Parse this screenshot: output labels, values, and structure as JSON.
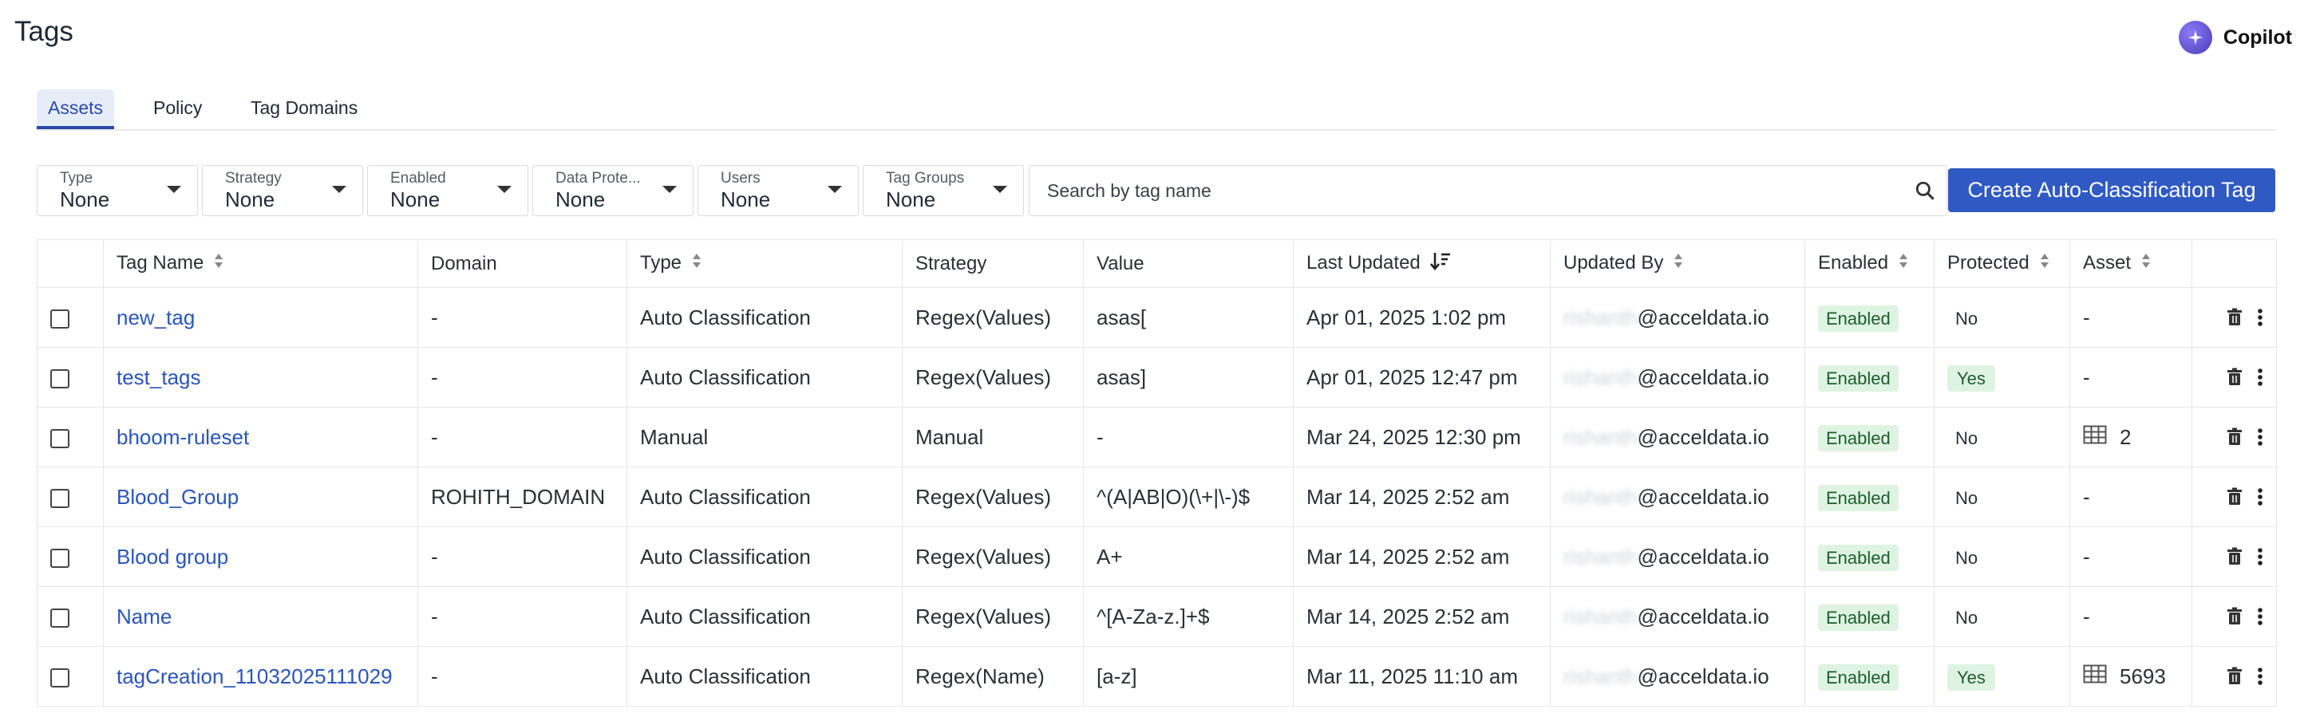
{
  "page": {
    "title": "Tags"
  },
  "copilot": {
    "label": "Copilot"
  },
  "tabs": [
    {
      "label": "Assets",
      "active": true
    },
    {
      "label": "Policy",
      "active": false
    },
    {
      "label": "Tag Domains",
      "active": false
    }
  ],
  "filters": [
    {
      "label": "Type",
      "value": "None"
    },
    {
      "label": "Strategy",
      "value": "None"
    },
    {
      "label": "Enabled",
      "value": "None"
    },
    {
      "label": "Data Prote...",
      "value": "None"
    },
    {
      "label": "Users",
      "value": "None"
    },
    {
      "label": "Tag Groups",
      "value": "None"
    }
  ],
  "search": {
    "placeholder": "Search by tag name"
  },
  "create_button": {
    "label": "Create Auto-Classification Tag"
  },
  "table": {
    "headers": {
      "tag_name": "Tag Name",
      "domain": "Domain",
      "type": "Type",
      "strategy": "Strategy",
      "value": "Value",
      "last_updated": "Last Updated",
      "updated_by": "Updated By",
      "enabled": "Enabled",
      "protected": "Protected",
      "asset": "Asset"
    },
    "rows": [
      {
        "name": "new_tag",
        "domain": "-",
        "type": "Auto Classification",
        "strategy": "Regex(Values)",
        "value": "asas[",
        "updated": "Apr 01, 2025 1:02 pm",
        "user_blur": "rishanth",
        "user_domain": "@acceldata.io",
        "enabled": "Enabled",
        "protected": "No",
        "asset": "-"
      },
      {
        "name": "test_tags",
        "domain": "-",
        "type": "Auto Classification",
        "strategy": "Regex(Values)",
        "value": "asas]",
        "updated": "Apr 01, 2025 12:47 pm",
        "user_blur": "rishanth",
        "user_domain": "@acceldata.io",
        "enabled": "Enabled",
        "protected": "Yes",
        "asset": "-"
      },
      {
        "name": "bhoom-ruleset",
        "domain": "-",
        "type": "Manual",
        "strategy": "Manual",
        "value": "-",
        "updated": "Mar 24, 2025 12:30 pm",
        "user_blur": "rishanth",
        "user_domain": "@acceldata.io",
        "enabled": "Enabled",
        "protected": "No",
        "asset": "2"
      },
      {
        "name": "Blood_Group",
        "domain": "ROHITH_DOMAIN",
        "type": "Auto Classification",
        "strategy": "Regex(Values)",
        "value": "^(A|AB|O)(\\+|\\-)$",
        "updated": "Mar 14, 2025 2:52 am",
        "user_blur": "rishanth",
        "user_domain": "@acceldata.io",
        "enabled": "Enabled",
        "protected": "No",
        "asset": "-"
      },
      {
        "name": "Blood group",
        "domain": "-",
        "type": "Auto Classification",
        "strategy": "Regex(Values)",
        "value": "A+",
        "updated": "Mar 14, 2025 2:52 am",
        "user_blur": "rishanth",
        "user_domain": "@acceldata.io",
        "enabled": "Enabled",
        "protected": "No",
        "asset": "-"
      },
      {
        "name": "Name",
        "domain": "-",
        "type": "Auto Classification",
        "strategy": "Regex(Values)",
        "value": "^[A-Za-z.]+$",
        "updated": "Mar 14, 2025 2:52 am",
        "user_blur": "rishanth",
        "user_domain": "@acceldata.io",
        "enabled": "Enabled",
        "protected": "No",
        "asset": "-"
      },
      {
        "name": "tagCreation_11032025111029",
        "domain": "-",
        "type": "Auto Classification",
        "strategy": "Regex(Name)",
        "value": "[a-z]",
        "updated": "Mar 11, 2025 11:10 am",
        "user_blur": "rishanth",
        "user_domain": "@acceldata.io",
        "enabled": "Enabled",
        "protected": "Yes",
        "asset": "5693"
      }
    ]
  }
}
